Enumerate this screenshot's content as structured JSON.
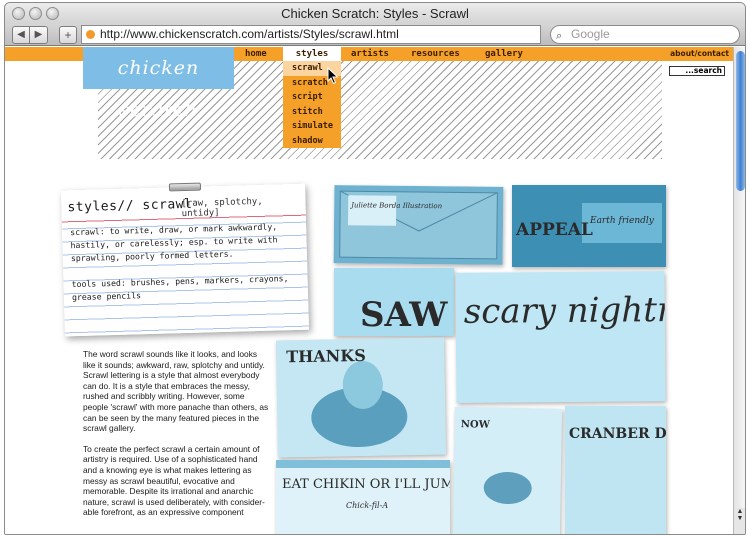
{
  "browser": {
    "window_title": "Chicken Scratch: Styles - Scrawl",
    "url": "http://www.chickenscratch.com/artists/Styles/scrawl.html",
    "search_placeholder": "Google",
    "back_label": "◀",
    "forward_label": "▶",
    "add_label": "+"
  },
  "site": {
    "logo_text": "chicken scratch",
    "nav": [
      "home",
      "styles",
      "artists",
      "resources",
      "gallery"
    ],
    "about_contact": "about/contact",
    "search_label": "...search",
    "styles_menu": [
      "scrawl",
      "scratch",
      "script",
      "stitch",
      "simulate",
      "shadow"
    ]
  },
  "card": {
    "title": "styles// scrawl",
    "subtitle": "[raw, splotchy, untidy]",
    "definition": "scrawl: to write, draw, or mark awkwardly, hastily, or carelessly; esp. to write with sprawling, poorly formed letters.",
    "tools": "tools used: brushes, pens, markers, crayons, grease pencils"
  },
  "body": {
    "p1": "The word scrawl sounds like it looks, and looks like it sounds; awkward, raw, splotchy and untidy.  Scrawl lettering is a style that almost everybody can do. It is a style that embraces the messy, rushed and scribbly writing. However, some people 'scrawl' with more panache than others, as can be seen by the many featured pieces in the scrawl gallery.",
    "p2": "To create the perfect scrawl a certain amount of artistry is required. Use of a sophisticated hand and a knowing eye is what makes lettering as messy as scrawl beautiful, evocative and memorable. Despite its irrational and anarchic nature, scrawl is used deliberately, with consider-able forefront, as an expressive component"
  },
  "photos": {
    "p1": "Juliette Borda Illustration",
    "p2": "APPEAL",
    "p2b": "Earth friendly",
    "p3": "SAW",
    "p4": "scary nightmare",
    "p5": "THANKS",
    "p6": "EAT CHIKIN OR I'LL JUM",
    "p6b": "Chick-fil-A",
    "p7": "NOW",
    "p8": "CRANBER DOV WEEZ MAR"
  },
  "colors": {
    "accent": "#f5a028",
    "logo_bg": "#7dbde6",
    "photo_tint": "#7ccbe6"
  }
}
